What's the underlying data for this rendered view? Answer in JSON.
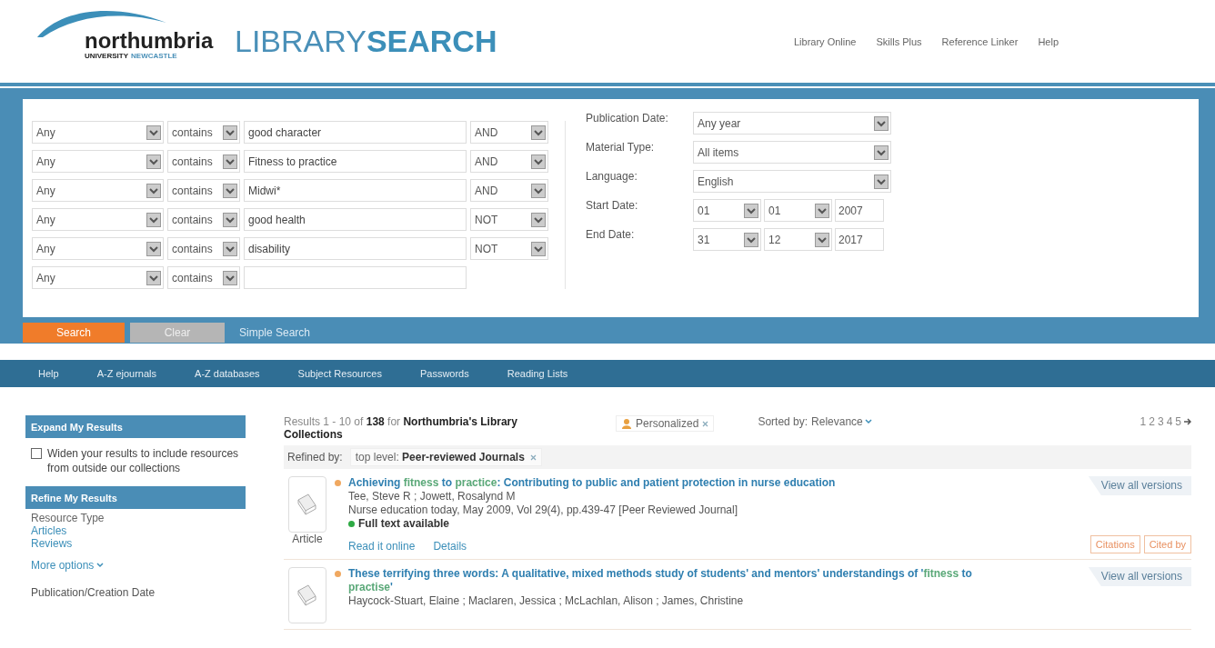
{
  "header": {
    "logo": {
      "name": "northumbria",
      "line1": "UNIVERSITY",
      "line2": "NEWCASTLE"
    },
    "title": [
      "LIBRARY",
      "SEARCH"
    ],
    "links": [
      "Library Online",
      "Skills Plus",
      "Reference Linker",
      "Help"
    ]
  },
  "search": {
    "rows": [
      {
        "field": "Any",
        "operator": "contains",
        "term": "good character",
        "boolean": "AND"
      },
      {
        "field": "Any",
        "operator": "contains",
        "term": "Fitness to practice",
        "boolean": "AND"
      },
      {
        "field": "Any",
        "operator": "contains",
        "term": "Midwi*",
        "boolean": "AND"
      },
      {
        "field": "Any",
        "operator": "contains",
        "term": "good health",
        "boolean": "NOT"
      },
      {
        "field": "Any",
        "operator": "contains",
        "term": "disability",
        "boolean": "NOT"
      },
      {
        "field": "Any",
        "operator": "contains"
      }
    ],
    "filters": [
      {
        "kind": "select",
        "label": "Publication Date:",
        "value": "Any year"
      },
      {
        "kind": "select",
        "label": "Material Type:",
        "value": "All items"
      },
      {
        "kind": "select",
        "label": "Language:",
        "value": "English"
      },
      {
        "kind": "date",
        "label": "Start Date:",
        "day": "01",
        "month": "01",
        "year": "2007"
      },
      {
        "kind": "date",
        "label": "End Date:",
        "day": "31",
        "month": "12",
        "year": "2017"
      }
    ],
    "buttons": [
      {
        "kind": "primary",
        "label": "Search"
      },
      {
        "kind": "secondary",
        "label": "Clear"
      },
      {
        "kind": "link",
        "label": "Simple Search"
      }
    ]
  },
  "nav": [
    "Help",
    "A-Z ejournals",
    "A-Z databases",
    "Subject Resources",
    "Passwords",
    "Reading Lists"
  ],
  "sidebar": {
    "expand": {
      "title": "Expand My Results",
      "checked": false,
      "label": "Widen your results to include resources from outside our collections"
    },
    "refine": {
      "title": "Refine My Results",
      "facet": "Resource Type",
      "options": [
        "Articles",
        "Reviews"
      ],
      "more": "More options",
      "next_facet": "Publication/Creation Date"
    }
  },
  "results": {
    "summary": "Results 1 - 10 of **138** for **Northumbria's Library Collections**",
    "personalized": "Personalized",
    "sort_label": "Sorted by:",
    "sort_value": "Relevance",
    "pages": [
      "1",
      "2",
      "3",
      "4",
      "5"
    ],
    "refined_label": "Refined by:",
    "refined_chip": "top level: **Peer-reviewed Journals**",
    "items": [
      {
        "type": "Article",
        "title": "Achieving **fitness** to **practice**: Contributing to public and patient protection in nurse education",
        "authors": "Tee, Steve R ; Jowett, Rosalynd M",
        "source": "Nurse education today, May 2009, Vol 29(4), pp.439-47 [Peer Reviewed Journal]",
        "availability": "Full text available",
        "links": [
          "Read it online",
          "Details"
        ],
        "versions": "View all versions",
        "actions": [
          "Citations",
          "Cited by"
        ]
      },
      {
        "title": "These terrifying three words: A qualitative, mixed methods study of students' and mentors' understandings of '**fitness** to **practise**'",
        "authors": "Haycock-Stuart, Elaine ; Maclaren, Jessica ; McLachlan, Alison ; James, Christine",
        "versions": "View all versions"
      }
    ]
  }
}
